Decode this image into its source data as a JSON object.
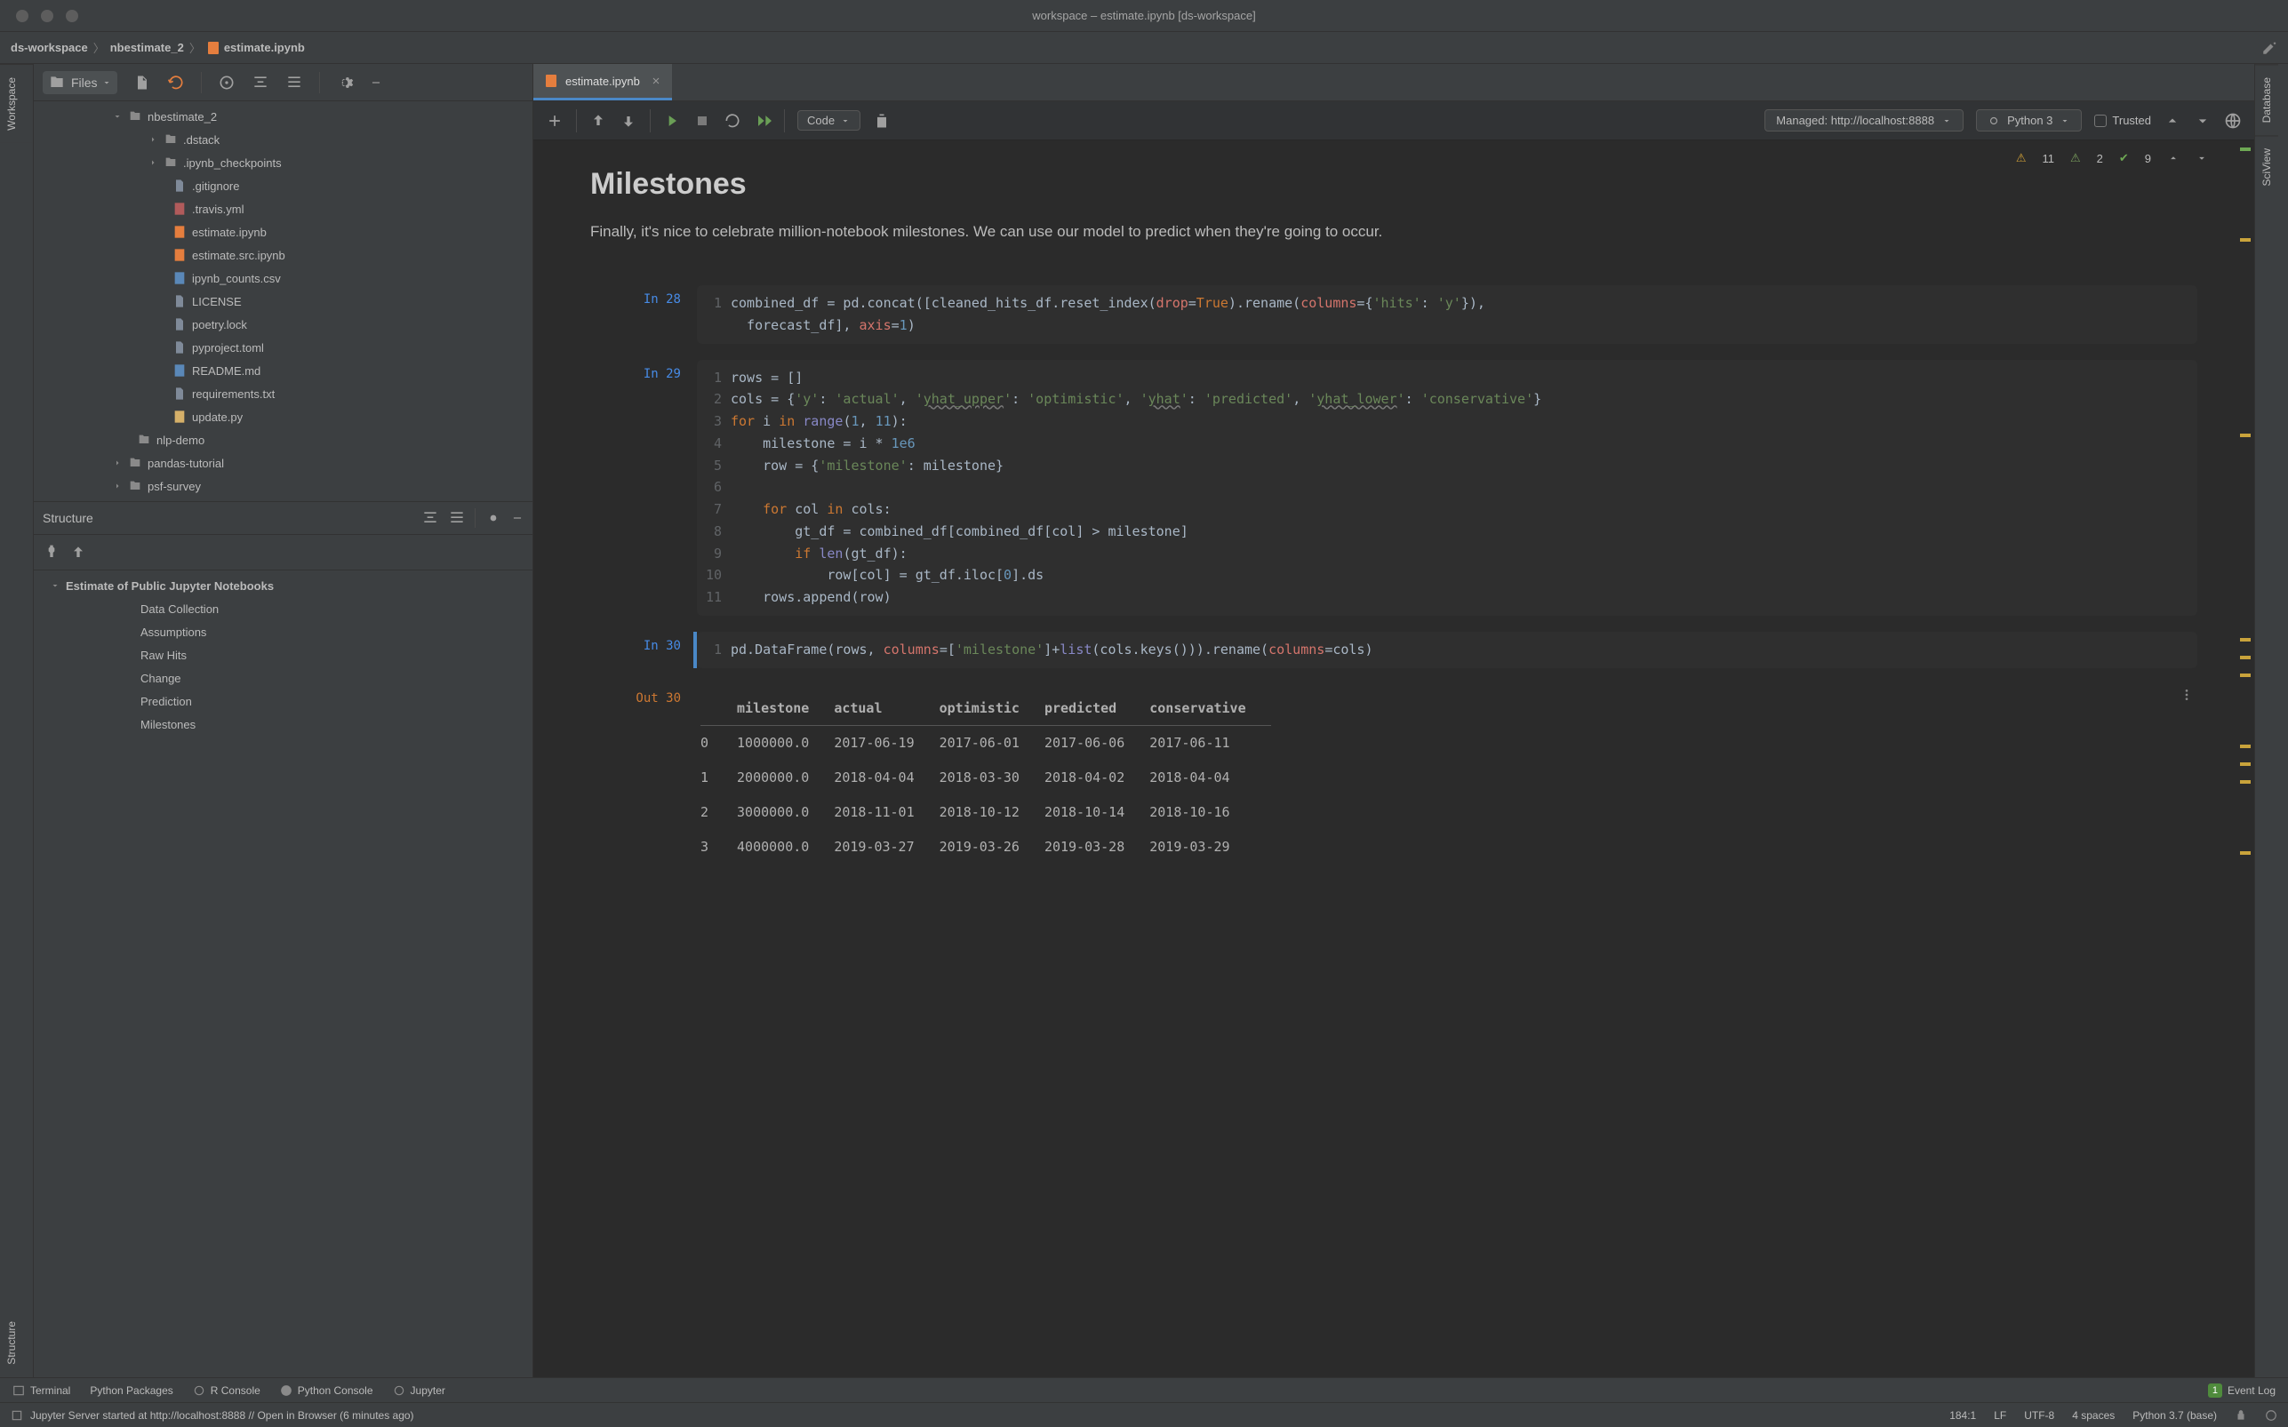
{
  "window": {
    "title": "workspace – estimate.ipynb [ds-workspace]"
  },
  "breadcrumbs": [
    "ds-workspace",
    "nbestimate_2",
    "estimate.ipynb"
  ],
  "left_rail": {
    "top_tab": "Workspace",
    "bottom_tab": "Structure"
  },
  "right_rail": {
    "tabs": [
      "Database",
      "SciView"
    ]
  },
  "files_toolbar": {
    "label": "Files"
  },
  "file_tree": [
    {
      "name": "nbestimate_2",
      "type": "folder",
      "indent": 1,
      "expanded": true
    },
    {
      "name": ".dstack",
      "type": "folder",
      "indent": 3
    },
    {
      "name": ".ipynb_checkpoints",
      "type": "folder",
      "indent": 3
    },
    {
      "name": ".gitignore",
      "type": "txt",
      "indent": 2
    },
    {
      "name": ".travis.yml",
      "type": "yml",
      "indent": 2
    },
    {
      "name": "estimate.ipynb",
      "type": "ipynb",
      "indent": 2
    },
    {
      "name": "estimate.src.ipynb",
      "type": "ipynb",
      "indent": 2
    },
    {
      "name": "ipynb_counts.csv",
      "type": "csv",
      "indent": 2
    },
    {
      "name": "LICENSE",
      "type": "txt",
      "indent": 2
    },
    {
      "name": "poetry.lock",
      "type": "txt",
      "indent": 2
    },
    {
      "name": "pyproject.toml",
      "type": "txt",
      "indent": 2
    },
    {
      "name": "README.md",
      "type": "md",
      "indent": 2
    },
    {
      "name": "requirements.txt",
      "type": "txt",
      "indent": 2
    },
    {
      "name": "update.py",
      "type": "py",
      "indent": 2
    },
    {
      "name": "nlp-demo",
      "type": "folder",
      "indent": 1
    },
    {
      "name": "pandas-tutorial",
      "type": "folder",
      "indent": 1,
      "hasarrow": true
    },
    {
      "name": "psf-survey",
      "type": "folder",
      "indent": 1,
      "hasarrow": true
    }
  ],
  "structure": {
    "title": "Structure",
    "root": "Estimate of Public Jupyter Notebooks",
    "items": [
      "Data Collection",
      "Assumptions",
      "Raw Hits",
      "Change",
      "Prediction",
      "Milestones"
    ]
  },
  "editor_tab": {
    "label": "estimate.ipynb"
  },
  "nb_toolbar": {
    "cell_type": "Code",
    "managed": "Managed: http://localhost:8888",
    "kernel": "Python 3",
    "trusted": "Trusted"
  },
  "inspector": {
    "yellow": "11",
    "green_tri": "2",
    "green_check": "9"
  },
  "markdown": {
    "heading": "Milestones",
    "body": "Finally, it's nice to celebrate million-notebook milestones. We can use our model to predict when they're going to occur."
  },
  "cells": {
    "c28": {
      "prompt": "In 28"
    },
    "c29": {
      "prompt": "In 29"
    },
    "c30": {
      "prompt": "In 30"
    },
    "out30": {
      "prompt": "Out 30"
    }
  },
  "out_table": {
    "headers": [
      "",
      "milestone",
      "actual",
      "optimistic",
      "predicted",
      "conservative"
    ],
    "rows": [
      [
        "0",
        "1000000.0",
        "2017-06-19",
        "2017-06-01",
        "2017-06-06",
        "2017-06-11"
      ],
      [
        "1",
        "2000000.0",
        "2018-04-04",
        "2018-03-30",
        "2018-04-02",
        "2018-04-04"
      ],
      [
        "2",
        "3000000.0",
        "2018-11-01",
        "2018-10-12",
        "2018-10-14",
        "2018-10-16"
      ],
      [
        "3",
        "4000000.0",
        "2019-03-27",
        "2019-03-26",
        "2019-03-28",
        "2019-03-29"
      ]
    ]
  },
  "bottom_tools": [
    "Terminal",
    "Python Packages",
    "R Console",
    "Python Console",
    "Jupyter"
  ],
  "event_log": {
    "badge": "1",
    "label": "Event Log"
  },
  "status": {
    "server_msg": "Jupyter Server started at http://localhost:8888 // Open in Browser (6 minutes ago)",
    "pos": "184:1",
    "line_sep": "LF",
    "encoding": "UTF-8",
    "indent": "4 spaces",
    "interpreter": "Python 3.7 (base)"
  }
}
